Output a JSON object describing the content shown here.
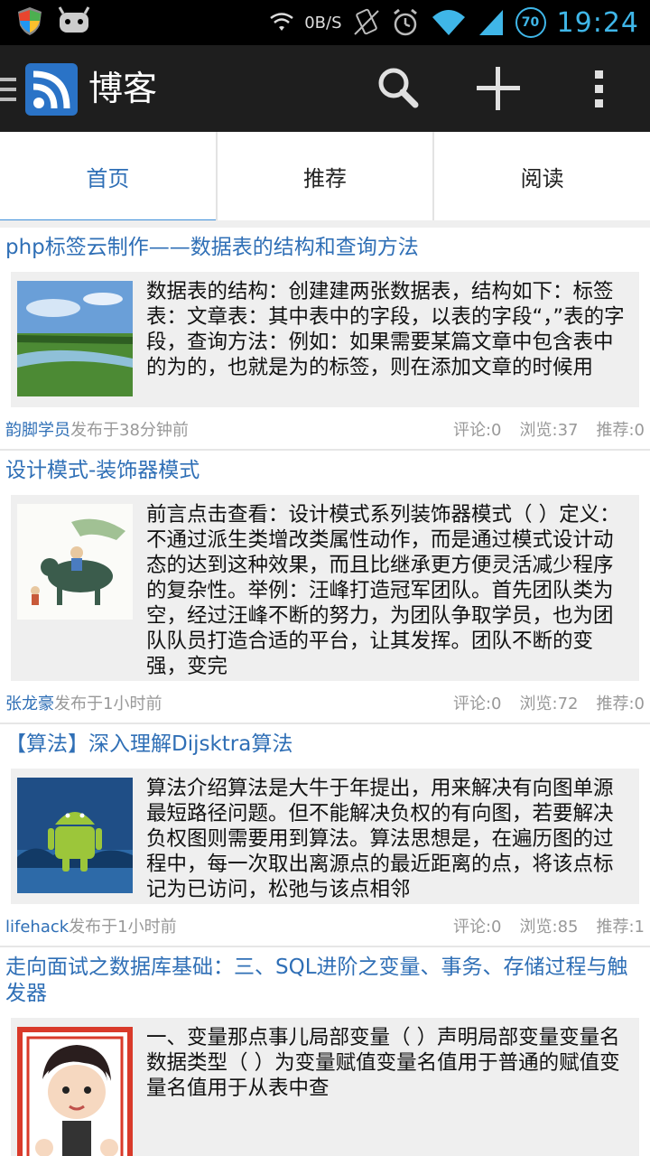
{
  "status_bar": {
    "net_speed": "0B/S",
    "battery": "70",
    "time": "19:24"
  },
  "action_bar": {
    "title": "博客",
    "icons": [
      "menu-icon",
      "rss-icon",
      "search-icon",
      "add-icon",
      "overflow-icon"
    ]
  },
  "tabs": [
    {
      "label": "首页",
      "active": true
    },
    {
      "label": "推荐",
      "active": false
    },
    {
      "label": "阅读",
      "active": false
    }
  ],
  "articles": [
    {
      "title": "php标签云制作——数据表的结构和查询方法",
      "summary": "数据表的结构：创建建两张数据表，结构如下：标签表：文章表：其中表中的字段，以表的字段“，”表的字段，查询方法：例如：如果需要某篇文章中包含表中的为的，也就是为的标签，则在添加文章的时候用",
      "author": "韵脚学员",
      "published": "发布于38分钟前",
      "comments": "评论:0",
      "views": "浏览:37",
      "recommends": "推荐:0"
    },
    {
      "title": "设计模式-装饰器模式",
      "summary": "前言点击查看：设计模式系列装饰器模式（ ）定义：不通过派生类增改类属性动作，而是通过模式设计动态的达到这种效果，而且比继承更方便灵活减少程序的复杂性。举例：汪峰打造冠军团队。首先团队类为空，经过汪峰不断的努力，为团队争取学员，也为团队队员打造合适的平台，让其发挥。团队不断的变强，变完",
      "author": "张龙豪",
      "published": "发布于1小时前",
      "comments": "评论:0",
      "views": "浏览:72",
      "recommends": "推荐:0"
    },
    {
      "title": "【算法】深入理解Dijsktra算法",
      "summary": "算法介绍算法是大牛于年提出，用来解决有向图单源最短路径问题。但不能解决负权的有向图，若要解决负权图则需要用到算法。算法思想是，在遍历图的过程中，每一次取出离源点的最近距离的点，将该点标记为已访问，松弛与该点相邻",
      "author": "lifehack",
      "published": "发布于1小时前",
      "comments": "评论:0",
      "views": "浏览:85",
      "recommends": "推荐:1"
    },
    {
      "title": "走向面试之数据库基础：三、SQL进阶之变量、事务、存储过程与触发器",
      "summary": "一、变量那点事儿局部变量（ ）声明局部变量变量名数据类型（ ）为变量赋值变量名值用于普通的赋值变量名值用于从表中查",
      "author": "",
      "published": "",
      "comments": "",
      "views": "",
      "recommends": ""
    }
  ]
}
